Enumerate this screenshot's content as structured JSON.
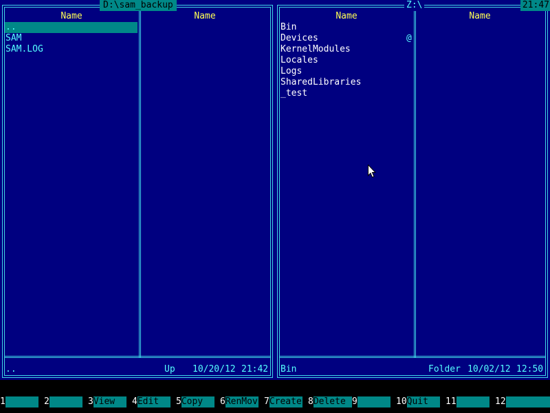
{
  "left_panel": {
    "path": "D:\\sam_backup",
    "columns": [
      "Name",
      "Name"
    ],
    "files": [
      "..",
      "SAM",
      "SAM.LOG"
    ],
    "selected_index": 0,
    "status": {
      "name": "..",
      "type": "Up",
      "date": "10/20/12",
      "time": "21:42"
    }
  },
  "right_panel": {
    "path": "Z:\\",
    "columns": [
      "Name",
      "Name"
    ],
    "files": [
      "Bin",
      "Devices",
      "KernelModules",
      "Locales",
      "Logs",
      "SharedLibraries",
      "_test"
    ],
    "marker": "@",
    "status": {
      "name": "Bin",
      "type": "Folder",
      "date": "10/02/12",
      "time": "12:50"
    }
  },
  "clock": "21:47",
  "function_keys": [
    {
      "num": "1",
      "label": ""
    },
    {
      "num": "2",
      "label": ""
    },
    {
      "num": "3",
      "label": "View"
    },
    {
      "num": "4",
      "label": "Edit"
    },
    {
      "num": "5",
      "label": "Copy"
    },
    {
      "num": "6",
      "label": "RenMov"
    },
    {
      "num": "7",
      "label": "Create"
    },
    {
      "num": "8",
      "label": "Delete"
    },
    {
      "num": "9",
      "label": ""
    },
    {
      "num": "10",
      "label": "Quit"
    },
    {
      "num": "11",
      "label": ""
    },
    {
      "num": "12",
      "label": ""
    }
  ],
  "colors": {
    "panel_bg": "#000080",
    "frame": "#3fd6e6",
    "header_text": "#ffff55",
    "file_text_left": "#55ffff",
    "file_text_right": "#ffffff",
    "selection_bg": "#008888",
    "keybar_label_bg": "#008888"
  }
}
